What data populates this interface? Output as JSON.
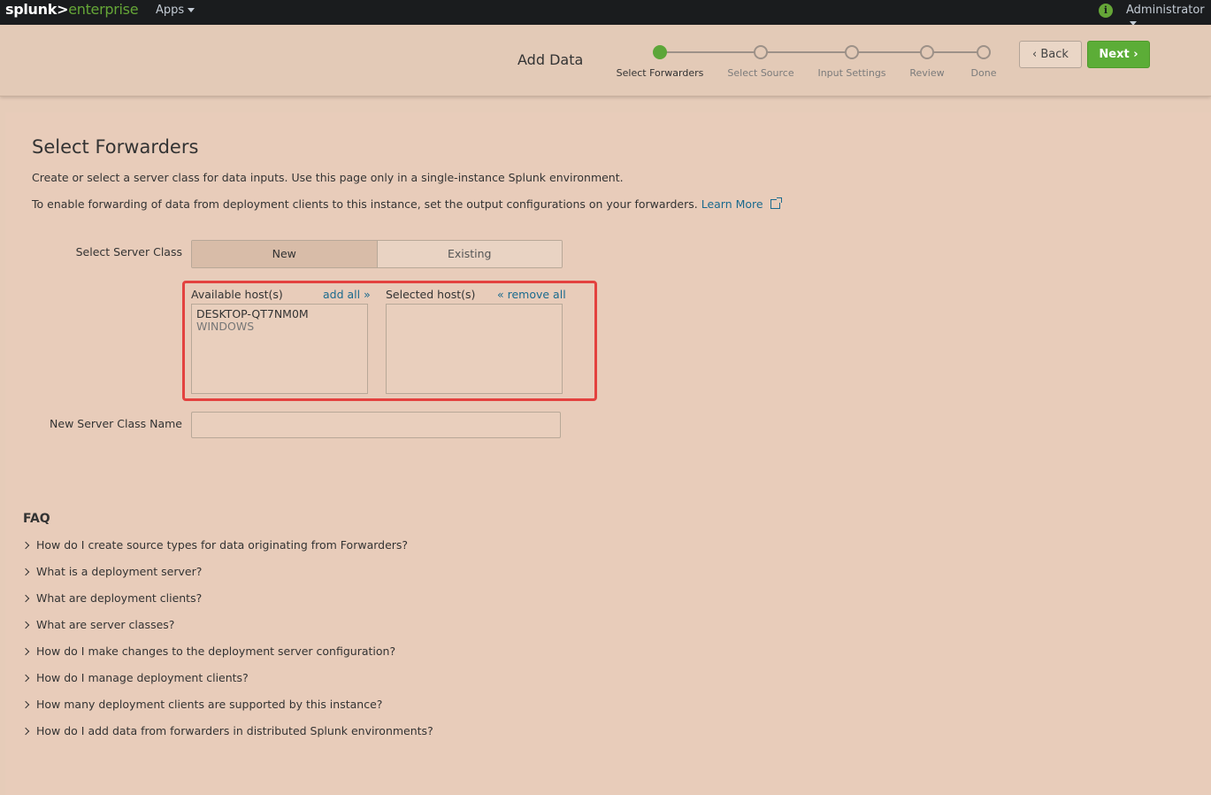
{
  "topbar": {
    "logo_left": "splunk>",
    "logo_right": "enterprise",
    "apps_label": "Apps",
    "info_glyph": "i",
    "user_label": "Administrator"
  },
  "header": {
    "title": "Add Data",
    "steps": [
      {
        "label": "Select Forwarders",
        "active": true
      },
      {
        "label": "Select Source",
        "active": false
      },
      {
        "label": "Input Settings",
        "active": false
      },
      {
        "label": "Review",
        "active": false
      },
      {
        "label": "Done",
        "active": false
      }
    ],
    "back_label": "Back",
    "next_label": "Next"
  },
  "page": {
    "title": "Select Forwarders",
    "desc1": "Create or select a server class for data inputs. Use this page only in a single-instance Splunk environment.",
    "desc2": "To enable forwarding of data from deployment clients to this instance, set the output configurations on your forwarders.",
    "learn_more": "Learn More"
  },
  "form": {
    "server_class_label": "Select Server Class",
    "seg_new": "New",
    "seg_existing": "Existing",
    "selected_segment": "New",
    "available_label": "Available host(s)",
    "add_all": "add all »",
    "selected_label": "Selected host(s)",
    "remove_all": "« remove all",
    "available_hosts": [
      {
        "name": "DESKTOP-QT7NM0M",
        "os": "WINDOWS"
      }
    ],
    "selected_hosts": [],
    "name_label": "New Server Class Name",
    "name_value": ""
  },
  "faq": {
    "title": "FAQ",
    "items": [
      "How do I create source types for data originating from Forwarders?",
      "What is a deployment server?",
      "What are deployment clients?",
      "What are server classes?",
      "How do I make changes to the deployment server configuration?",
      "How do I manage deployment clients?",
      "How many deployment clients are supported by this instance?",
      "How do I add data from forwarders in distributed Splunk environments?"
    ]
  },
  "colors": {
    "accent_green": "#5cad37",
    "link_blue": "#1a6a8e",
    "highlight_red": "#e3423f"
  }
}
